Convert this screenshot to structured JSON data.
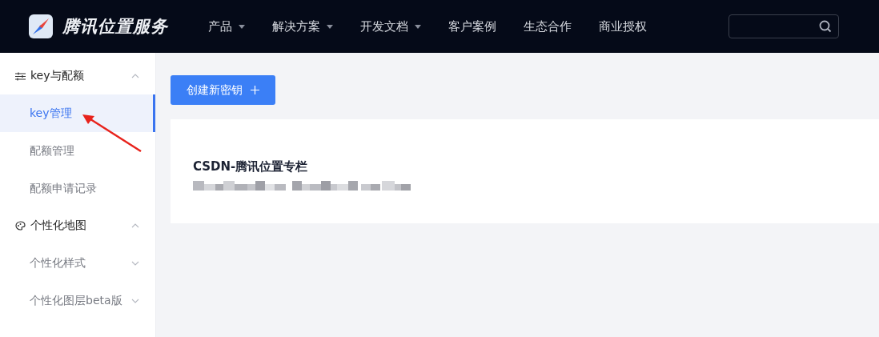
{
  "header": {
    "logo_text": "腾讯位置服务",
    "nav": [
      {
        "label": "产品",
        "dropdown": true
      },
      {
        "label": "解决方案",
        "dropdown": true
      },
      {
        "label": "开发文档",
        "dropdown": true
      },
      {
        "label": "客户案例",
        "dropdown": false
      },
      {
        "label": "生态合作",
        "dropdown": false
      },
      {
        "label": "商业授权",
        "dropdown": false
      }
    ]
  },
  "sidebar": {
    "groups": [
      {
        "label": "key与配额",
        "expanded": true,
        "items": [
          {
            "label": "key管理",
            "kind": "link",
            "selected": true
          },
          {
            "label": "配额管理",
            "kind": "link",
            "selected": false
          },
          {
            "label": "配额申请记录",
            "kind": "link",
            "selected": false
          }
        ]
      },
      {
        "label": "个性化地图",
        "expanded": true,
        "items": [
          {
            "label": "个性化样式",
            "kind": "submenu",
            "selected": false,
            "expanded": false
          },
          {
            "label": "个性化图层beta版",
            "kind": "submenu",
            "selected": false,
            "expanded": false
          }
        ]
      }
    ]
  },
  "main": {
    "create_button": "创建新密钥",
    "card": {
      "title": "CSDN-腾讯位置专栏"
    }
  }
}
